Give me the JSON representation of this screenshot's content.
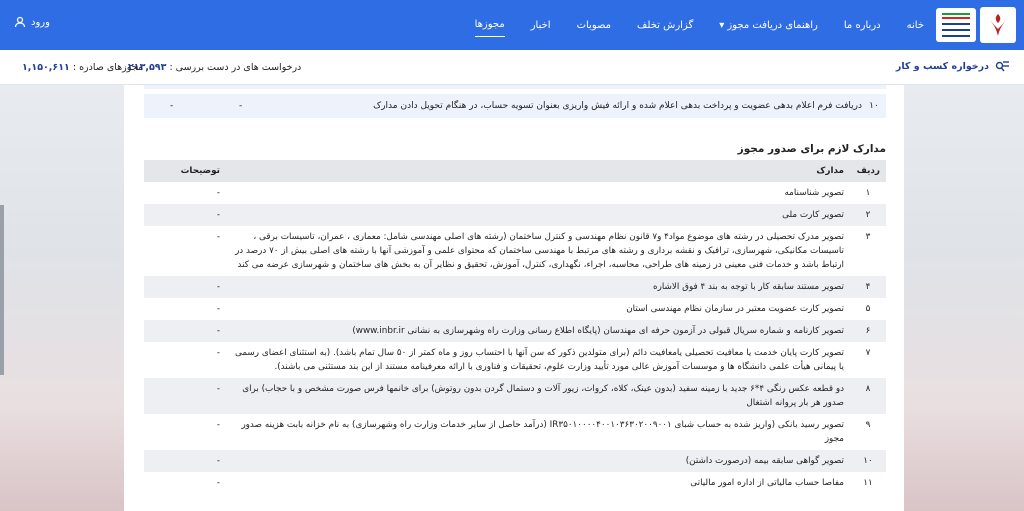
{
  "nav": {
    "items": [
      {
        "label": "خانه",
        "active": false
      },
      {
        "label": "درباره ما",
        "active": false
      },
      {
        "label": "راهنمای دریافت مجوز",
        "active": false,
        "dropdown": true
      },
      {
        "label": "گزارش تخلف",
        "active": false
      },
      {
        "label": "مصوبات",
        "active": false
      },
      {
        "label": "اخبار",
        "active": false
      },
      {
        "label": "مجوزها",
        "active": true
      }
    ],
    "login_label": "ورود"
  },
  "subheader": {
    "request_label": "درخواره کسب و کار",
    "pending_label": "درخواست های در دست بررسی :",
    "pending_value": "۲۱۳,۵۹۳",
    "issued_label": "مجوزهای صادره :",
    "issued_value": "۱,۱۵۰,۶۱۱"
  },
  "prev_table": {
    "row10": {
      "num": "۱۰",
      "text": "دریافت فرم اعلام بدهی عضویت و پرداخت بدهی اعلام شده و ارائه فیش واریزی بعنوان تسویه حساب، در هنگام تحویل دادن مدارک",
      "col1": "-",
      "col2": "-"
    }
  },
  "section_title": "مدارک لازم برای صدور مجوز",
  "table": {
    "headers": {
      "num": "ردیف",
      "doc": "مدارک",
      "note": "توضیحات"
    },
    "rows": [
      {
        "num": "۱",
        "doc": "تصویر شناسنامه",
        "note": "-"
      },
      {
        "num": "۲",
        "doc": "تصویر کارت ملی",
        "note": "-"
      },
      {
        "num": "۳",
        "doc": "تصویر مدرک تحصیلی در رشته های موضوع مواد۴ و۷ قانون نظام مهندسی و کنترل ساختمان (رشته های اصلی مهندسی شامل: معماری ، عمران، تاسیسات برقی ، تاسیسات مکانیکی، شهرسازی، ترافیک و نقشه برداری و رشته های مرتبط با مهندسی ساختمان که محتوای علمی و آموزشی آنها با رشته های اصلی بیش از ۷۰ درصد در ارتباط باشد و خدمات فنی معینی در زمینه های طراحی، محاسبه، اجراء، نگهداری، کنترل، آموزش، تحقیق و نظایر آن به بخش های ساختمان و شهرسازی عرضه می کند",
        "note": "-"
      },
      {
        "num": "۴",
        "doc": "تصویر مستند سابقه کار با توجه به بند ۴ فوق الاشاره",
        "note": "-"
      },
      {
        "num": "۵",
        "doc": "تصویر کارت عضویت معتبر در سازمان نظام مهندسی استان",
        "note": "-"
      },
      {
        "num": "۶",
        "doc": "تصویر کارنامه و شماره سریال قبولی در آزمون حرفه ای مهندسان (پایگاه اطلاع رسانی وزارت راه وشهرسازی به نشانی www.inbr.ir)",
        "note": "-"
      },
      {
        "num": "۷",
        "doc": "تصویر کارت پایان خدمت یا معافیت تحصیلی یامعافیت دائم (برای متولدین ذکور که سن آنها با احتساب روز و ماه کمتر از ۵۰ سال تمام باشد). (به استثنای اعضای رسمی یا پیمانی هیأت علمی دانشگاه ها و موسسات آموزش عالی مورد تأیید وزارت علوم، تحقیقات و فناوری با ارائه معرفینامه مستند از این بند مستثنی می باشند).",
        "note": "-"
      },
      {
        "num": "۸",
        "doc": "دو قطعه عکس رنگی ۴*۶ جدید با زمینه سفید (بدون عینک، کلاه، کروات، زیور آلات و دستمال گردن بدون روتوش) برای خانمها فرس صورت مشخص و با حجاب) برای صدور هر بار پروانه اشتغال",
        "note": "-"
      },
      {
        "num": "۹",
        "doc": "تصویر رسید بانکی (واریز شده به حساب شبای IR۳۵۰۱۰۰۰۰۴۰۰۱۰۳۶۳۰۲۰۰۹۰۰۱ (درآمد حاصل از سایر خدمات وزارت راه وشهرسازی) به نام خزانه بابت هزینه صدور مجوز",
        "note": "-"
      },
      {
        "num": "۱۰",
        "doc": "تصویر گواهی سابقه بیمه (درصورت داشتن)",
        "note": "-"
      },
      {
        "num": "۱۱",
        "doc": "مفاصا حساب مالیاتی از اداره امور مالیاتی",
        "note": "-"
      }
    ]
  },
  "icons": {
    "logo": "ministry-emblem",
    "search": "search-icon",
    "login": "login-icon",
    "chevron": "chevron-down-icon"
  },
  "colors": {
    "nav_bg": "#2f6de5",
    "accent": "#1f3f9a",
    "row_alt": "#eeeff2",
    "header": "#e4e6ea"
  }
}
